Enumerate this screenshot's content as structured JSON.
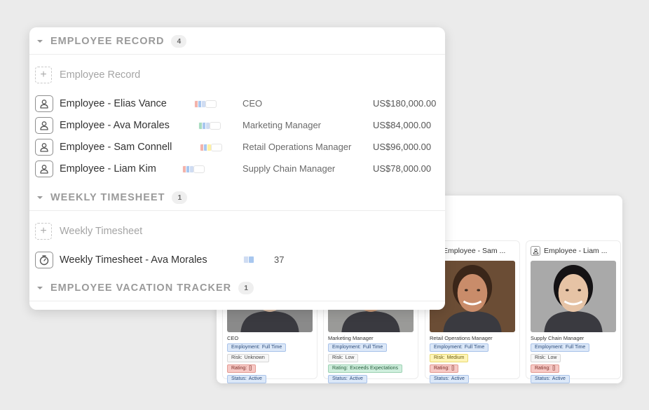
{
  "sections": [
    {
      "title": "EMPLOYEE RECORD",
      "count": "4",
      "add_label": "Employee Record",
      "records": [
        {
          "name": "Employee - Elias Vance",
          "role": "CEO",
          "salary": "US$180,000.00",
          "chips": [
            "#f3b3ab",
            "#a8c7ef",
            "#cfdcf2"
          ]
        },
        {
          "name": "Employee - Ava Morales",
          "role": "Marketing Manager",
          "salary": "US$84,000.00",
          "chips": [
            "#a9dcc0",
            "#a8c7ef",
            "#cfdcf2"
          ]
        },
        {
          "name": "Employee - Sam Connell",
          "role": "Retail Operations Manager",
          "salary": "US$96,000.00",
          "chips": [
            "#f3b3ab",
            "#a8c7ef",
            "#fff1a3"
          ]
        },
        {
          "name": "Employee - Liam Kim",
          "role": "Supply Chain Manager",
          "salary": "US$78,000.00",
          "chips": [
            "#f3b3ab",
            "#a8c7ef",
            "#cfdcf2"
          ]
        }
      ]
    },
    {
      "title": "WEEKLY TIMESHEET",
      "count": "1",
      "add_label": "Weekly Timesheet",
      "records": [
        {
          "name": "Weekly Timesheet - Ava Morales",
          "value": "37",
          "chips": [
            "#cfdcf2",
            "#a8c7ef"
          ]
        }
      ]
    },
    {
      "title": "EMPLOYEE VACATION TRACKER",
      "count": "1"
    }
  ],
  "gallery": {
    "cards": [
      {
        "header": "",
        "title": "CEO",
        "skin": "#d7b9a2",
        "hair": "#d8d8d8",
        "bg": "#8a8a8a",
        "tags": [
          {
            "cls": "t-blue",
            "key": "Employment:",
            "val": "Full Time"
          },
          {
            "cls": "t-gray",
            "key": "Risk:",
            "val": "Unknown"
          },
          {
            "cls": "t-red",
            "key": "Rating:",
            "val": "[]"
          },
          {
            "cls": "t-blue",
            "key": "Status:",
            "val": "Active"
          }
        ]
      },
      {
        "header": "",
        "title": "Marketing Manager",
        "skin": "#c89a7a",
        "hair": "#2b211b",
        "bg": "#9a9a98",
        "tags": [
          {
            "cls": "t-blue",
            "key": "Employment:",
            "val": "Full Time"
          },
          {
            "cls": "t-gray",
            "key": "Risk:",
            "val": "Low"
          },
          {
            "cls": "t-green",
            "key": "Rating:",
            "val": "Exceeds Expectations"
          },
          {
            "cls": "t-blue",
            "key": "Status:",
            "val": "Active"
          }
        ]
      },
      {
        "header": "Employee - Sam ...",
        "title": "Retail Operations Manager",
        "skin": "#c98c6a",
        "hair": "#3a2619",
        "bg": "#6b4d35",
        "tags": [
          {
            "cls": "t-blue",
            "key": "Employment:",
            "val": "Full Time"
          },
          {
            "cls": "t-yellow",
            "key": "Risk:",
            "val": "Medium"
          },
          {
            "cls": "t-red",
            "key": "Rating:",
            "val": "[]"
          },
          {
            "cls": "t-blue",
            "key": "Status:",
            "val": "Active"
          }
        ]
      },
      {
        "header": "Employee - Liam ...",
        "title": "Supply Chain Manager",
        "skin": "#e6c3a5",
        "hair": "#141214",
        "bg": "#a9a9a9",
        "tags": [
          {
            "cls": "t-blue",
            "key": "Employment:",
            "val": "Full Time"
          },
          {
            "cls": "t-gray",
            "key": "Risk:",
            "val": "Low"
          },
          {
            "cls": "t-red",
            "key": "Rating:",
            "val": "[]"
          },
          {
            "cls": "t-blue",
            "key": "Status:",
            "val": "Active"
          }
        ]
      }
    ]
  }
}
